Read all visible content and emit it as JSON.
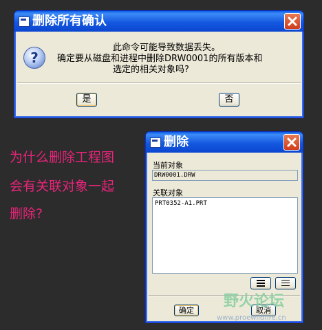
{
  "confirm_dialog": {
    "title": "删除所有确认",
    "message_lines": [
      "此命令可能导致数据丢失。",
      "确定要从磁盘和进程中删除DRW0001的所有版本和",
      "选定的相关对象吗?"
    ],
    "icon": "question-icon",
    "yes_label": "是",
    "no_label": "否"
  },
  "delete_dialog": {
    "title": "删除",
    "current_object_label": "当前对象",
    "current_object_value": "DRW0001.DRW",
    "related_objects_label": "关联对象",
    "related_objects": [
      "PRT0352-A1.PRT"
    ],
    "ok_label": "确定",
    "cancel_label": "取消"
  },
  "annotation": {
    "lines": [
      "为什么删除工程图",
      "会有关联对象一起",
      "删除?"
    ]
  },
  "watermark": {
    "logo_text": "野火论坛",
    "url": "www.proewildfire.cn"
  },
  "colors": {
    "titlebar": "#1458e0",
    "annotation": "#e8247a",
    "close": "#cf3d1c"
  }
}
